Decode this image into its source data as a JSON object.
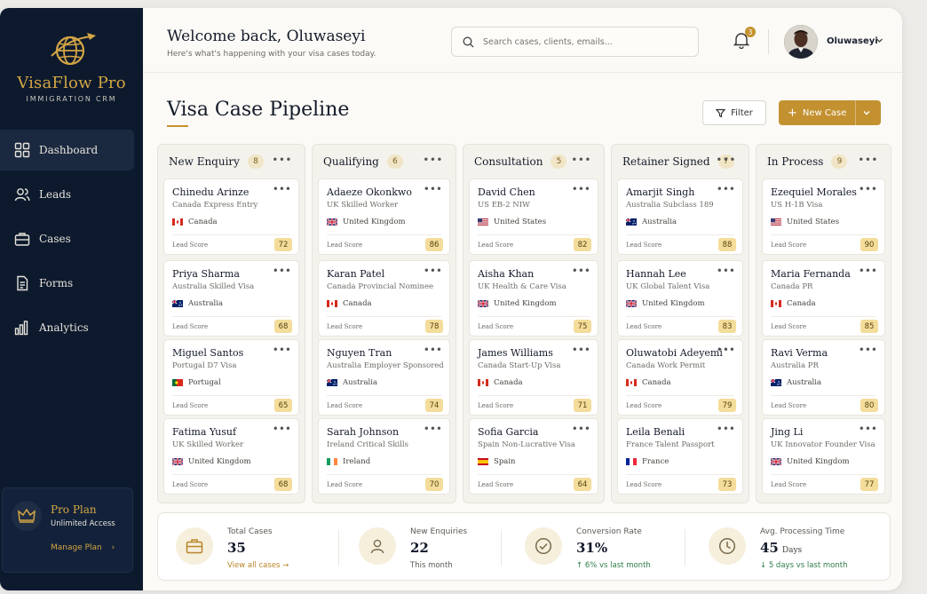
{
  "app": {
    "name": "VisaFlow Pro",
    "tagline": "IMMIGRATION CRM"
  },
  "sidebar": {
    "items": [
      {
        "label": "Dashboard",
        "icon": "dashboard-icon",
        "active": true
      },
      {
        "label": "Leads",
        "icon": "users-icon",
        "active": false
      },
      {
        "label": "Cases",
        "icon": "briefcase-icon",
        "active": false
      },
      {
        "label": "Forms",
        "icon": "document-icon",
        "active": false
      },
      {
        "label": "Analytics",
        "icon": "bar-chart-icon",
        "active": false
      }
    ],
    "plan": {
      "title": "Pro Plan",
      "subtitle": "Unlimited Access",
      "link": "Manage Plan"
    }
  },
  "header": {
    "welcome": "Welcome back, Oluwaseyi",
    "subtitle": "Here's what's happening with your visa cases today.",
    "search_placeholder": "Search cases, clients, emails...",
    "notifications": "3",
    "user_name": "Oluwaseyi"
  },
  "page": {
    "title": "Visa Case Pipeline",
    "filter_label": "Filter",
    "new_case_label": "New Case"
  },
  "columns": [
    {
      "title": "New Enquiry",
      "count": "8",
      "cards": [
        {
          "name": "Chinedu Arinze",
          "visa": "Canada Express Entry",
          "country": "Canada",
          "flag": "ca",
          "score_label": "Lead Score",
          "score": "72"
        },
        {
          "name": "Priya Sharma",
          "visa": "Australia Skilled Visa",
          "country": "Australia",
          "flag": "au",
          "score_label": "Lead Score",
          "score": "68"
        },
        {
          "name": "Miguel Santos",
          "visa": "Portugal D7 Visa",
          "country": "Portugal",
          "flag": "pt",
          "score_label": "Lead Score",
          "score": "65"
        },
        {
          "name": "Fatima Yusuf",
          "visa": "UK Skilled Worker",
          "country": "United Kingdom",
          "flag": "uk",
          "score_label": "Lead Score",
          "score": "68"
        }
      ]
    },
    {
      "title": "Qualifying",
      "count": "6",
      "cards": [
        {
          "name": "Adaeze Okonkwo",
          "visa": "UK Skilled Worker",
          "country": "United Kingdom",
          "flag": "uk",
          "score_label": "Lead Score",
          "score": "86"
        },
        {
          "name": "Karan Patel",
          "visa": "Canada Provincial Nominee",
          "country": "Canada",
          "flag": "ca",
          "score_label": "Lead Score",
          "score": "78"
        },
        {
          "name": "Nguyen Tran",
          "visa": "Australia Employer Sponsored",
          "country": "Australia",
          "flag": "au",
          "score_label": "Lead Score",
          "score": "74"
        },
        {
          "name": "Sarah Johnson",
          "visa": "Ireland Critical Skills",
          "country": "Ireland",
          "flag": "ie",
          "score_label": "Lead Score",
          "score": "70"
        }
      ]
    },
    {
      "title": "Consultation",
      "count": "5",
      "cards": [
        {
          "name": "David Chen",
          "visa": "US EB-2 NIW",
          "country": "United States",
          "flag": "us",
          "score_label": "Lead Score",
          "score": "82"
        },
        {
          "name": "Aisha Khan",
          "visa": "UK Health & Care Visa",
          "country": "United Kingdom",
          "flag": "uk",
          "score_label": "Lead Score",
          "score": "75"
        },
        {
          "name": "James Williams",
          "visa": "Canada Start-Up Visa",
          "country": "Canada",
          "flag": "ca",
          "score_label": "Lead Score",
          "score": "71"
        },
        {
          "name": "Sofia Garcia",
          "visa": "Spain Non-Lucrative Visa",
          "country": "Spain",
          "flag": "es",
          "score_label": "Lead Score",
          "score": "64"
        }
      ]
    },
    {
      "title": "Retainer Signed",
      "count": "7",
      "cards": [
        {
          "name": "Amarjit Singh",
          "visa": "Australia Subclass 189",
          "country": "Australia",
          "flag": "au",
          "score_label": "Lead Score",
          "score": "88"
        },
        {
          "name": "Hannah Lee",
          "visa": "UK Global Talent Visa",
          "country": "United Kingdom",
          "flag": "uk",
          "score_label": "Lead Score",
          "score": "83"
        },
        {
          "name": "Oluwatobi Adeyemi",
          "visa": "Canada Work Permit",
          "country": "Canada",
          "flag": "ca",
          "score_label": "Lead Score",
          "score": "79"
        },
        {
          "name": "Leila Benali",
          "visa": "France Talent Passport",
          "country": "France",
          "flag": "fr",
          "score_label": "Lead Score",
          "score": "73"
        }
      ]
    },
    {
      "title": "In Process",
      "count": "9",
      "cards": [
        {
          "name": "Ezequiel Morales",
          "visa": "US H-1B Visa",
          "country": "United States",
          "flag": "us",
          "score_label": "Lead Score",
          "score": "90"
        },
        {
          "name": "Maria Fernanda",
          "visa": "Canada PR",
          "country": "Canada",
          "flag": "ca",
          "score_label": "Lead Score",
          "score": "85"
        },
        {
          "name": "Ravi Verma",
          "visa": "Australia PR",
          "country": "Australia",
          "flag": "au",
          "score_label": "Lead Score",
          "score": "80"
        },
        {
          "name": "Jing Li",
          "visa": "UK Innovator Founder Visa",
          "country": "United Kingdom",
          "flag": "uk",
          "score_label": "Lead Score",
          "score": "77"
        }
      ]
    }
  ],
  "stats": [
    {
      "label": "Total Cases",
      "value": "35",
      "unit": "",
      "footer": "View all cases →",
      "footer_color": "#b8862a",
      "icon": "briefcase-icon"
    },
    {
      "label": "New Enquiries",
      "value": "22",
      "unit": "",
      "footer": "This month",
      "footer_color": "#5c5a55",
      "icon": "user-icon"
    },
    {
      "label": "Conversion Rate",
      "value": "31%",
      "unit": "",
      "footer": "↑ 6% vs last month",
      "footer_color": "#2f7d4a",
      "icon": "check-circle-icon"
    },
    {
      "label": "Avg. Processing Time",
      "value": "45",
      "unit": "Days",
      "footer": "↓ 5 days vs last month",
      "footer_color": "#2f7d4a",
      "icon": "clock-icon"
    }
  ],
  "colors": {
    "sidebar_bg": "#0d1a2e",
    "accent_gold": "#c3912f",
    "score_badge": "#f4dc9a",
    "background": "#fbfaf6"
  }
}
